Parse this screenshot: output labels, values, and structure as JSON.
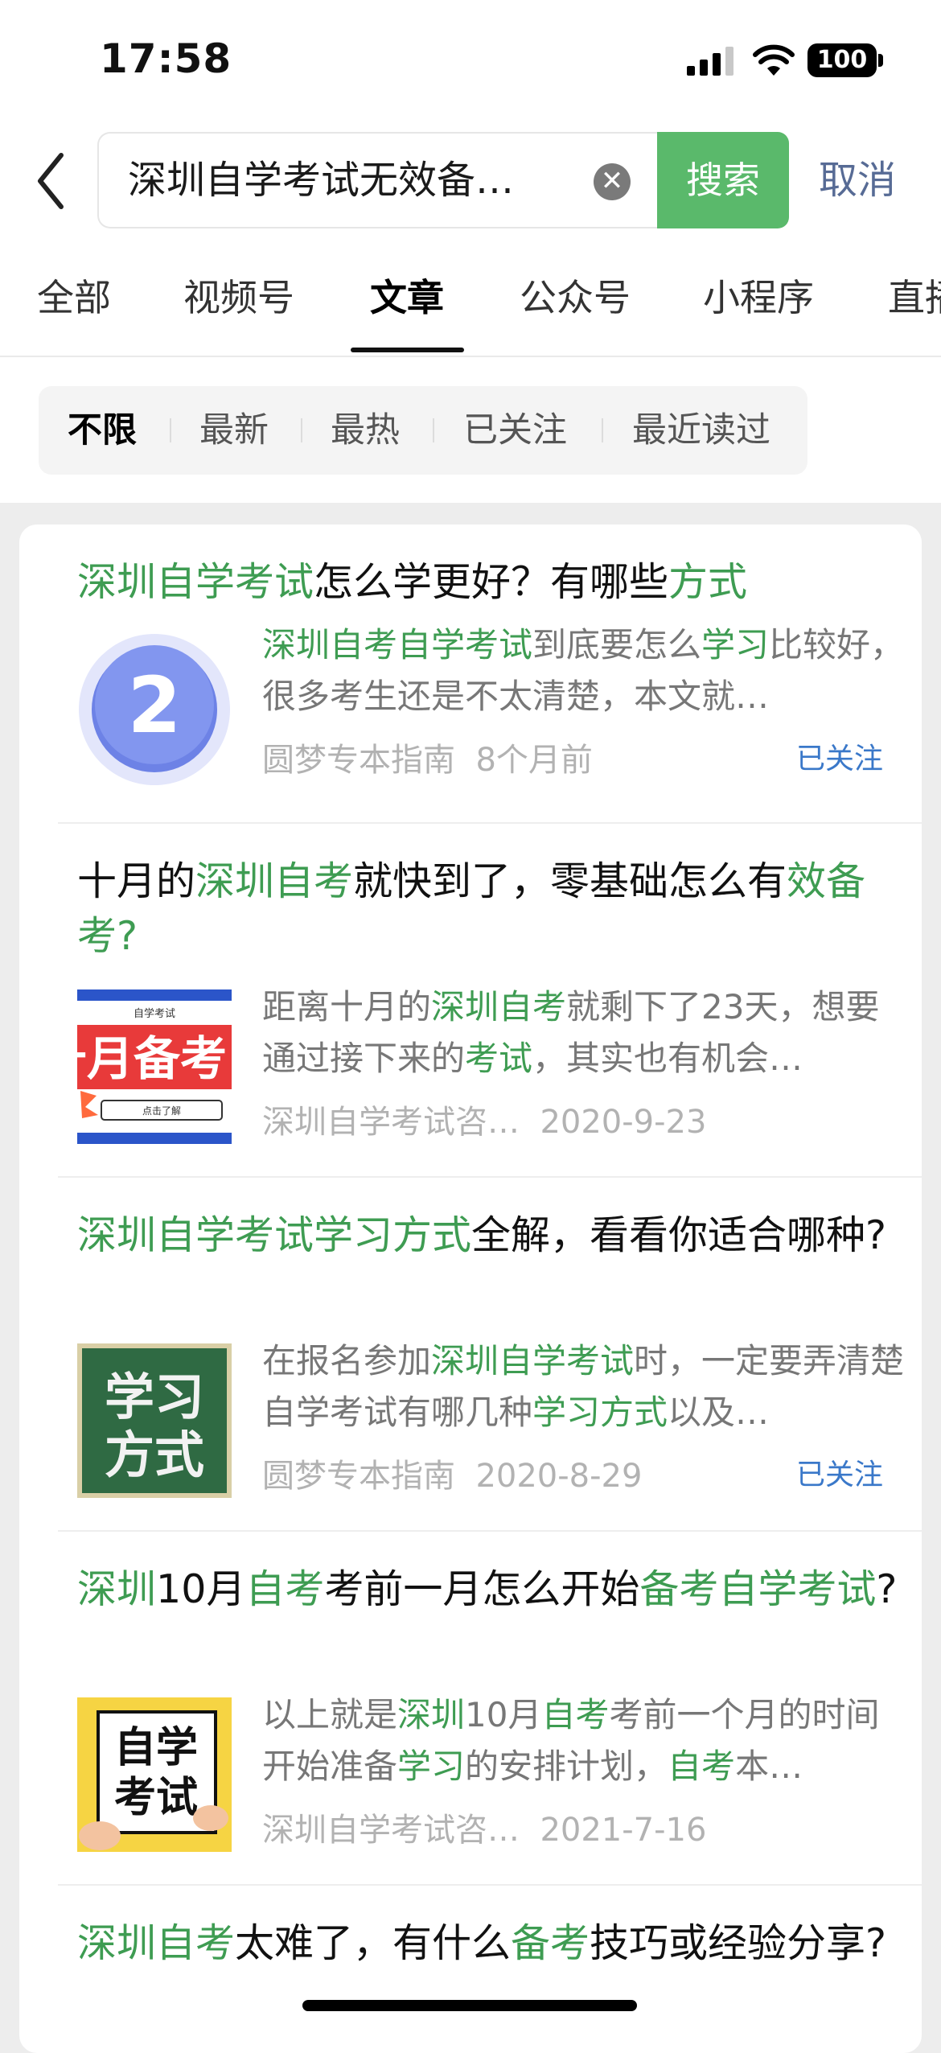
{
  "status": {
    "time": "17:58",
    "battery": "100"
  },
  "search": {
    "query": "深圳自学考试无效备…",
    "button": "搜索",
    "cancel": "取消"
  },
  "tabs": [
    "全部",
    "视频号",
    "文章",
    "公众号",
    "小程序",
    "直播"
  ],
  "active_tab": "文章",
  "filters": [
    "不限",
    "最新",
    "最热",
    "已关注",
    "最近读过"
  ],
  "active_filter": "不限",
  "results": [
    {
      "title": [
        {
          "t": "深圳自学考试",
          "h": true
        },
        {
          "t": "怎么学更好？有哪些"
        },
        {
          "t": "方式",
          "h": true
        }
      ],
      "snippet": [
        {
          "t": "深圳自考自学考试",
          "h": true
        },
        {
          "t": "到底要怎么"
        },
        {
          "t": "学习",
          "h": true
        },
        {
          "t": "比较好，很多考生还是不太清楚，本文就…"
        }
      ],
      "source": "圆梦专本指南",
      "date": "8个月前",
      "followed": "已关注",
      "thumb": "number-2"
    },
    {
      "title": [
        {
          "t": "十月的"
        },
        {
          "t": "深圳自考",
          "h": true
        },
        {
          "t": "就快到了，零基础怎么有"
        },
        {
          "t": "效备考?",
          "h": true
        }
      ],
      "snippet": [
        {
          "t": "距离十月的"
        },
        {
          "t": "深圳自考",
          "h": true
        },
        {
          "t": "就剩下了23天，想要通过接下来的"
        },
        {
          "t": "考试",
          "h": true
        },
        {
          "t": "，其实也有机会…"
        }
      ],
      "source": "深圳自学考试咨…",
      "date": "2020-9-23",
      "followed": "",
      "thumb": "october-banner",
      "thumb_text": {
        "top": "自学考试",
        "main": "十月备考",
        "button": "点击了解"
      }
    },
    {
      "title": [
        {
          "t": "深圳自学考试学习方式",
          "h": true
        },
        {
          "t": "全解，看看你适合哪种?"
        }
      ],
      "snippet": [
        {
          "t": "在报名参加"
        },
        {
          "t": "深圳自学考试",
          "h": true
        },
        {
          "t": "时，一定要弄清楚自学考试有哪几种"
        },
        {
          "t": "学习方式",
          "h": true
        },
        {
          "t": "以及…"
        }
      ],
      "source": "圆梦专本指南",
      "date": "2020-8-29",
      "followed": "已关注",
      "thumb": "chalkboard",
      "thumb_text": {
        "l1": "学习",
        "l2": "方式"
      }
    },
    {
      "title": [
        {
          "t": "深圳",
          "h": true
        },
        {
          "t": "10月"
        },
        {
          "t": "自考",
          "h": true
        },
        {
          "t": "考前一月怎么开始"
        },
        {
          "t": "备考自学考试",
          "h": true
        },
        {
          "t": "?"
        }
      ],
      "snippet": [
        {
          "t": "以上就是"
        },
        {
          "t": "深圳",
          "h": true
        },
        {
          "t": "10月"
        },
        {
          "t": "自考",
          "h": true
        },
        {
          "t": "考前一个月的时间开始准备"
        },
        {
          "t": "学习",
          "h": true
        },
        {
          "t": "的安排计划，"
        },
        {
          "t": "自考",
          "h": true
        },
        {
          "t": "本…"
        }
      ],
      "source": "深圳自学考试咨…",
      "date": "2021-7-16",
      "followed": "",
      "thumb": "sign",
      "thumb_text": {
        "l1": "自学",
        "l2": "考试"
      }
    },
    {
      "title": [
        {
          "t": "深圳自考",
          "h": true
        },
        {
          "t": "太难了，有什么"
        },
        {
          "t": "备考",
          "h": true
        },
        {
          "t": "技巧或经验分享?"
        }
      ],
      "snippet": [],
      "source": "",
      "date": "",
      "followed": "",
      "thumb": ""
    }
  ]
}
